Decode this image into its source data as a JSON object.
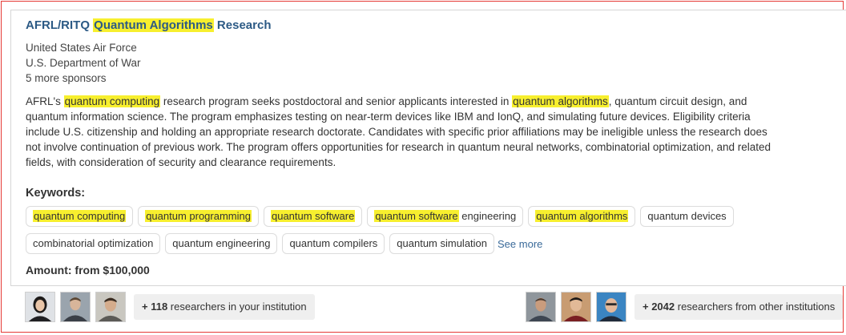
{
  "listing": {
    "title_prefix": "AFRL/RITQ ",
    "title_highlight": "Quantum Algorithms",
    "title_suffix": " Research",
    "sponsors": [
      "United States Air Force",
      "U.S. Department of War"
    ],
    "more_sponsors": "5 more sponsors",
    "description": [
      {
        "text": "AFRL's ",
        "hl": false
      },
      {
        "text": "quantum computing",
        "hl": true
      },
      {
        "text": " research program seeks postdoctoral and senior applicants interested in ",
        "hl": false
      },
      {
        "text": "quantum algorithms",
        "hl": true
      },
      {
        "text": ", quantum circuit design, and quantum information science. The program emphasizes testing on near-term devices like IBM and IonQ, and simulating future devices. Eligibility criteria include U.S. citizenship and holding an appropriate research doctorate. Candidates with specific prior affiliations may be ineligible unless the research does not involve continuation of previous work. The program offers opportunities for research in quantum neural networks, combinatorial optimization, and related fields, with consideration of security and clearance requirements.",
        "hl": false
      }
    ],
    "keywords_label": "Keywords:",
    "keywords_row1": [
      {
        "hl": "quantum computing",
        "rest": ""
      },
      {
        "hl": "quantum programming",
        "rest": ""
      },
      {
        "hl": "quantum software",
        "rest": ""
      },
      {
        "hl": "quantum software",
        "rest": " engineering"
      },
      {
        "hl": "quantum algorithms",
        "rest": ""
      },
      {
        "hl": "",
        "rest": "quantum devices"
      }
    ],
    "keywords_row2": [
      "combinatorial optimization",
      "quantum engineering",
      "quantum compilers",
      "quantum simulation"
    ],
    "see_more": "See more",
    "amount": "Amount: from $100,000"
  },
  "researchers": {
    "internal_count": "+ 118",
    "internal_text": " researchers in your institution",
    "external_count": "+ 2042",
    "external_text": " researchers from other institutions"
  },
  "colors": {
    "highlight": "#f7ef2e",
    "title": "#2c5a85",
    "link": "#3b6b9a",
    "frame": "#e53935"
  }
}
